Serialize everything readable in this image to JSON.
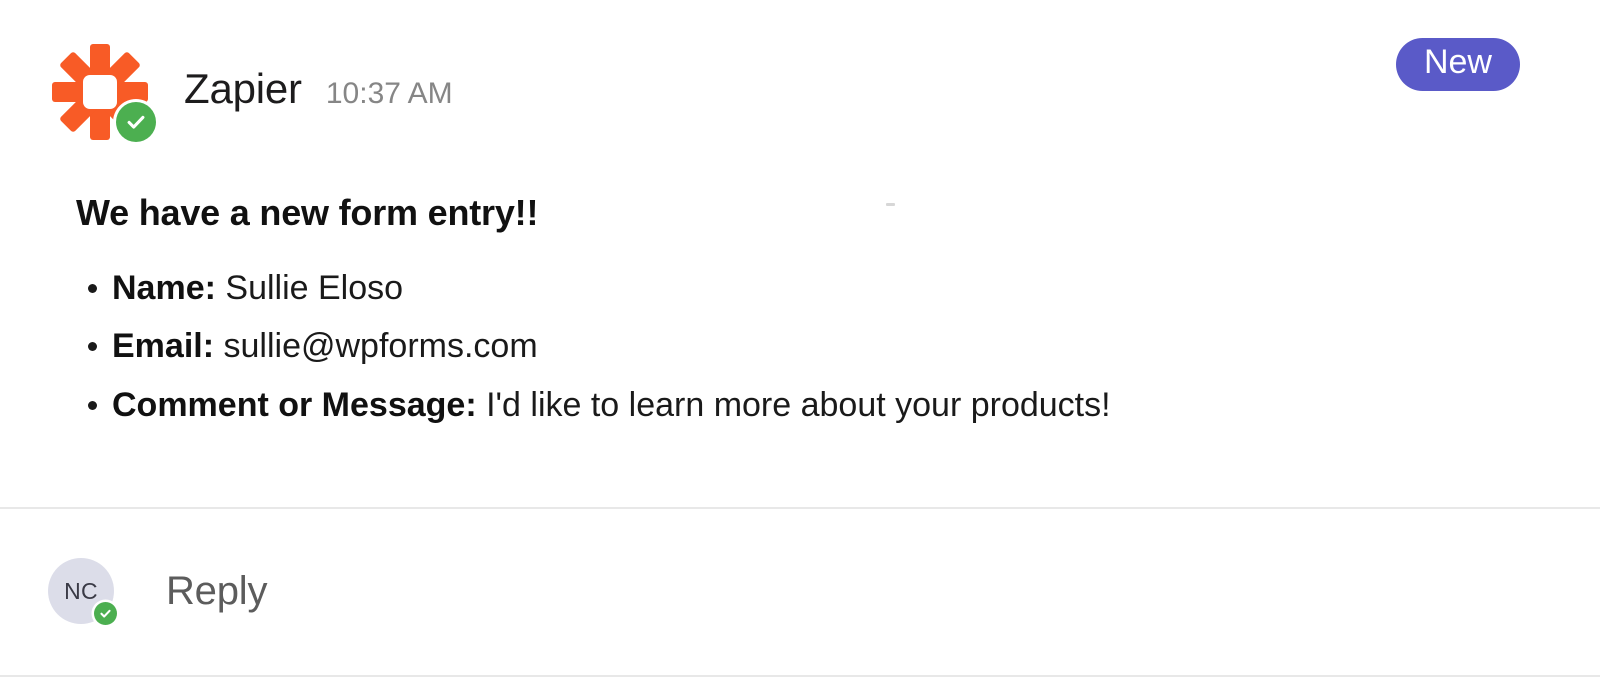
{
  "message": {
    "sender": "Zapier",
    "timestamp": "10:37 AM",
    "badge_label": "New",
    "badge_color": "#5A5AC8",
    "logo_color": "#F85B26",
    "presence_color": "#4CAF50",
    "heading": "We have a new form entry!!",
    "fields": [
      {
        "label": "Name:",
        "value": "Sullie Eloso"
      },
      {
        "label": "Email:",
        "value": "sullie@wpforms.com"
      },
      {
        "label": "Comment or Message:",
        "value": "I'd like to learn more about your products!"
      }
    ]
  },
  "reply": {
    "avatar_initials": "NC",
    "avatar_color": "#DCDDE9",
    "label": "Reply"
  }
}
